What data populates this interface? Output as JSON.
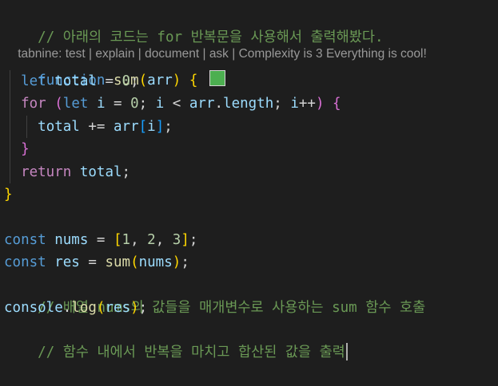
{
  "editor": {
    "swatch_color": "#4caf50",
    "lines": {
      "l1": {
        "comment": "// 아래의 코드는 for 반복문을 사용해서 출력해봤다."
      },
      "lens": {
        "test": "tabnine: test",
        "sep": " | ",
        "explain": "explain",
        "document": "document",
        "ask": "ask",
        "complexity": "Complexity is 3 Everything is cool!"
      },
      "l2": {
        "kw": "function",
        "sp": " ",
        "name": "sum",
        "open": "(",
        "param": "arr",
        "close": ")",
        "brace": "{"
      },
      "l3": {
        "kw": "let",
        "var": "total",
        "eq": " = ",
        "num": "0",
        "semi": ";"
      },
      "l4": {
        "kw": "for",
        "open": "(",
        "let": "let",
        "i": "i",
        "eq": " = ",
        "zero": "0",
        "semi1": "; ",
        "i2": "i",
        "lt": " < ",
        "arr": "arr",
        "dot": ".",
        "len": "length",
        "semi2": "; ",
        "i3": "i",
        "inc": "++",
        "close": ")",
        "brace": "{"
      },
      "l5": {
        "total": "total",
        "op": " += ",
        "arr": "arr",
        "open": "[",
        "i": "i",
        "close": "]",
        "semi": ";"
      },
      "l6": {
        "brace": "}"
      },
      "l7": {
        "kw": "return",
        "var": "total",
        "semi": ";"
      },
      "l8": {
        "brace": "}"
      },
      "l10": {
        "kw": "const",
        "var": "nums",
        "eq": " = ",
        "open": "[",
        "n1": "1",
        "c1": ", ",
        "n2": "2",
        "c2": ", ",
        "n3": "3",
        "close": "]",
        "semi": ";"
      },
      "l11": {
        "kw": "const",
        "var": "res",
        "eq": " = ",
        "fn": "sum",
        "open": "(",
        "arg": "nums",
        "close": ")",
        "semi": ";"
      },
      "l12": {
        "comment": "// 배열 nums의 값들을 매개변수로 사용하는 sum 함수 호출"
      },
      "l13": {
        "obj": "console",
        "dot": ".",
        "fn": "log",
        "open": "(",
        "arg": "res",
        "close": ")",
        "semi": ";"
      },
      "l14": {
        "comment": "// 함수 내에서 반복을 마치고 합산된 값을 출력"
      }
    }
  }
}
